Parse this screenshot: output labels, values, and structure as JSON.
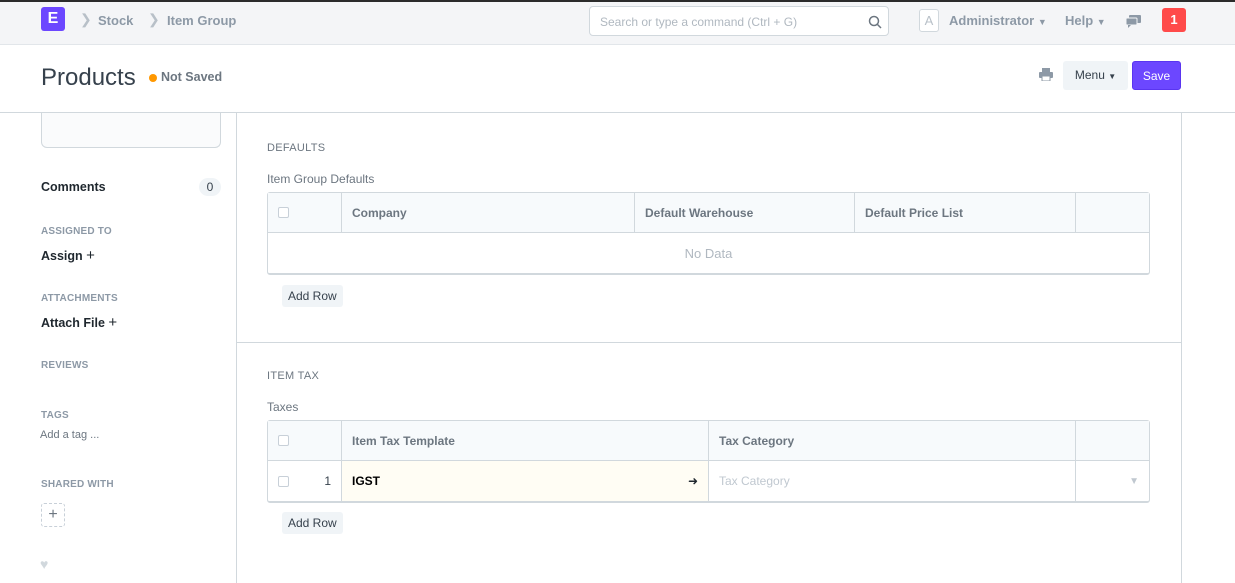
{
  "navbar": {
    "logo": "E",
    "breadcrumbs": [
      "Stock",
      "Item Group"
    ],
    "search_placeholder": "Search or type a command (Ctrl + G)",
    "avatar": "A",
    "user": "Administrator",
    "help": "Help",
    "notifications": "1"
  },
  "header": {
    "title": "Products",
    "status": "Not Saved",
    "menu_label": "Menu",
    "save_label": "Save"
  },
  "sidebar": {
    "comments": "Comments",
    "comments_count": "0",
    "assigned_to": "ASSIGNED TO",
    "assign": "Assign",
    "attachments": "ATTACHMENTS",
    "attach_file": "Attach File",
    "reviews": "REVIEWS",
    "tags": "TAGS",
    "add_tag": "Add a tag ...",
    "shared_with": "SHARED WITH"
  },
  "defaults": {
    "section": "DEFAULTS",
    "label": "Item Group Defaults",
    "columns": [
      "Company",
      "Default Warehouse",
      "Default Price List"
    ],
    "empty": "No Data",
    "add_row": "Add Row"
  },
  "item_tax": {
    "section": "ITEM TAX",
    "label": "Taxes",
    "columns": [
      "Item Tax Template",
      "Tax Category"
    ],
    "rows": [
      {
        "idx": "1",
        "template": "IGST",
        "category_placeholder": "Tax Category"
      }
    ],
    "add_row": "Add Row"
  },
  "colors": {
    "brand": "#6c47ff",
    "indicator": "#ff9800",
    "badge": "#ff4a4a"
  }
}
